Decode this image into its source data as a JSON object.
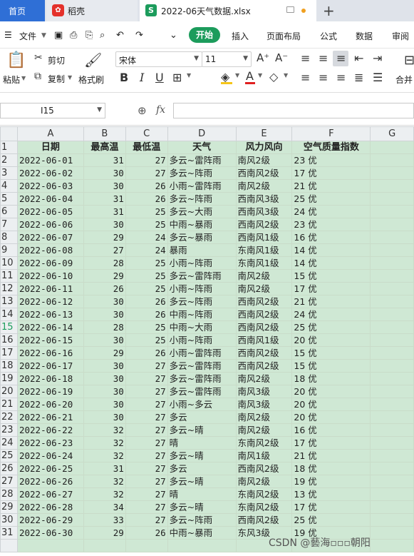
{
  "tabs": {
    "home": "首页",
    "doc": "稻壳",
    "file": "2022-06天气数据.xlsx"
  },
  "menu": {
    "file": "文件",
    "start": "开始",
    "insert": "插入",
    "layout": "页面布局",
    "formula": "公式",
    "data": "数据",
    "review": "审阅"
  },
  "ribbon": {
    "paste": "粘贴",
    "cut": "剪切",
    "copy": "复制",
    "format_painter": "格式刷",
    "font_name": "宋体",
    "font_size": "11",
    "merge": "合并"
  },
  "formula_bar": {
    "name_box": "I15",
    "fx": "fx"
  },
  "sheet": {
    "columns": [
      "A",
      "B",
      "C",
      "D",
      "E",
      "F",
      "G"
    ],
    "headers": [
      "日期",
      "最高温",
      "最低温",
      "天气",
      "风力风向",
      "空气质量指数"
    ],
    "active_row": 15,
    "rows": [
      [
        "2022-06-01",
        "31",
        "27",
        "多云~雷阵雨",
        "南风2级",
        "23 优"
      ],
      [
        "2022-06-02",
        "30",
        "27",
        "多云~阵雨",
        "西南风2级",
        "17 优"
      ],
      [
        "2022-06-03",
        "30",
        "26",
        "小雨~雷阵雨",
        "南风2级",
        "21 优"
      ],
      [
        "2022-06-04",
        "31",
        "26",
        "多云~阵雨",
        "西南风3级",
        "25 优"
      ],
      [
        "2022-06-05",
        "31",
        "25",
        "多云~大雨",
        "西南风3级",
        "24 优"
      ],
      [
        "2022-06-06",
        "30",
        "25",
        "中雨~暴雨",
        "西南风2级",
        "23 优"
      ],
      [
        "2022-06-07",
        "29",
        "24",
        "多云~暴雨",
        "西南风1级",
        "16 优"
      ],
      [
        "2022-06-08",
        "27",
        "24",
        "暴雨",
        "东南风1级",
        "14 优"
      ],
      [
        "2022-06-09",
        "28",
        "25",
        "小雨~阵雨",
        "东南风1级",
        "14 优"
      ],
      [
        "2022-06-10",
        "29",
        "25",
        "多云~雷阵雨",
        "南风2级",
        "15 优"
      ],
      [
        "2022-06-11",
        "26",
        "25",
        "小雨~阵雨",
        "南风2级",
        "17 优"
      ],
      [
        "2022-06-12",
        "30",
        "26",
        "多云~阵雨",
        "西南风2级",
        "21 优"
      ],
      [
        "2022-06-13",
        "30",
        "26",
        "中雨~阵雨",
        "西南风2级",
        "24 优"
      ],
      [
        "2022-06-14",
        "28",
        "25",
        "中雨~大雨",
        "西南风2级",
        "25 优"
      ],
      [
        "2022-06-15",
        "30",
        "25",
        "小雨~阵雨",
        "西南风1级",
        "20 优"
      ],
      [
        "2022-06-16",
        "29",
        "26",
        "小雨~雷阵雨",
        "西南风2级",
        "15 优"
      ],
      [
        "2022-06-17",
        "30",
        "27",
        "多云~雷阵雨",
        "西南风2级",
        "15 优"
      ],
      [
        "2022-06-18",
        "30",
        "27",
        "多云~雷阵雨",
        "南风2级",
        "18 优"
      ],
      [
        "2022-06-19",
        "30",
        "27",
        "多云~雷阵雨",
        "南风3级",
        "20 优"
      ],
      [
        "2022-06-20",
        "30",
        "27",
        "小雨~多云",
        "南风3级",
        "20 优"
      ],
      [
        "2022-06-21",
        "30",
        "27",
        "多云",
        "南风2级",
        "20 优"
      ],
      [
        "2022-06-22",
        "32",
        "27",
        "多云~晴",
        "南风2级",
        "16 优"
      ],
      [
        "2022-06-23",
        "32",
        "27",
        "晴",
        "东南风2级",
        "17 优"
      ],
      [
        "2022-06-24",
        "32",
        "27",
        "多云~晴",
        "南风1级",
        "21 优"
      ],
      [
        "2022-06-25",
        "31",
        "27",
        "多云",
        "西南风2级",
        "18 优"
      ],
      [
        "2022-06-26",
        "32",
        "27",
        "多云~晴",
        "南风2级",
        "19 优"
      ],
      [
        "2022-06-27",
        "32",
        "27",
        "晴",
        "东南风2级",
        "13 优"
      ],
      [
        "2022-06-28",
        "34",
        "27",
        "多云~晴",
        "东南风2级",
        "17 优"
      ],
      [
        "2022-06-29",
        "33",
        "27",
        "多云~阵雨",
        "西南风2级",
        "25 优"
      ],
      [
        "2022-06-30",
        "29",
        "26",
        "中雨~暴雨",
        "东风3级",
        "19 优"
      ]
    ]
  },
  "watermark": "CSDN @藝海▫▫▫朝阳"
}
